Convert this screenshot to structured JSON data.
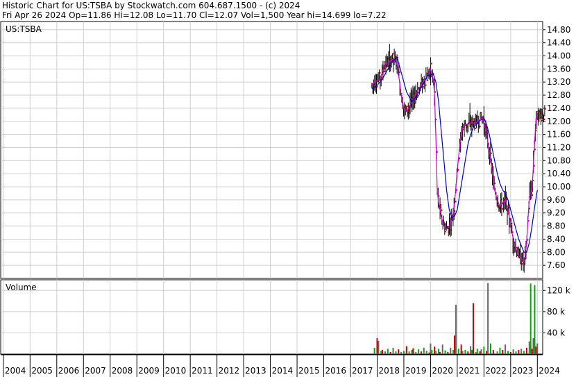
{
  "header": {
    "line1": "Historic Chart for US:TSBA by Stockwatch.com 604.687.1500 - (c) 2024",
    "line2": "Fri Apr 26 2024   Op=11.86   Hi=12.08   Lo=11.70   Cl=12.07   Vol=1,500   Year hi=14.699   lo=7.22"
  },
  "chart_data": [
    {
      "type": "line",
      "title": "US:TSBA",
      "ylim": [
        7.22,
        14.9
      ],
      "yticks": [
        "14.80",
        "14.40",
        "14.00",
        "13.60",
        "13.20",
        "12.80",
        "12.40",
        "12.00",
        "11.60",
        "11.20",
        "10.80",
        "10.40",
        "10.00",
        "9.60",
        "9.20",
        "8.80",
        "8.40",
        "8.00",
        "7.60"
      ],
      "colors": {
        "price_bar": "#000000",
        "down_tick": "#cc0000",
        "short_ma": "#cc00cc",
        "long_ma": "#0000cc"
      },
      "series": [
        {
          "values": [
            [
              2017.8,
              13.1
            ],
            [
              2017.9,
              13.2
            ],
            [
              2018.0,
              13.25
            ],
            [
              2018.1,
              13.3
            ],
            [
              2018.2,
              13.5
            ],
            [
              2018.3,
              13.75
            ],
            [
              2018.4,
              13.8
            ],
            [
              2018.5,
              13.85
            ],
            [
              2018.6,
              13.9
            ],
            [
              2018.75,
              13.8
            ],
            [
              2018.9,
              12.8
            ],
            [
              2019.0,
              12.4
            ],
            [
              2019.1,
              12.3
            ],
            [
              2019.3,
              12.6
            ],
            [
              2019.5,
              12.9
            ],
            [
              2019.7,
              13.2
            ],
            [
              2019.9,
              13.4
            ],
            [
              2020.0,
              13.6
            ],
            [
              2020.1,
              13.3
            ],
            [
              2020.15,
              12.8
            ],
            [
              2020.2,
              11.5
            ],
            [
              2020.25,
              9.9
            ],
            [
              2020.3,
              9.5
            ],
            [
              2020.4,
              9.1
            ],
            [
              2020.5,
              8.8
            ],
            [
              2020.6,
              8.7
            ],
            [
              2020.7,
              8.8
            ],
            [
              2020.8,
              9.0
            ],
            [
              2020.9,
              9.5
            ],
            [
              2021.0,
              10.5
            ],
            [
              2021.1,
              11.3
            ],
            [
              2021.2,
              11.8
            ],
            [
              2021.3,
              11.9
            ],
            [
              2021.5,
              11.95
            ],
            [
              2021.7,
              11.95
            ],
            [
              2021.9,
              12.1
            ],
            [
              2022.0,
              12.0
            ],
            [
              2022.1,
              11.6
            ],
            [
              2022.2,
              11.1
            ],
            [
              2022.3,
              10.5
            ],
            [
              2022.4,
              9.9
            ],
            [
              2022.5,
              9.6
            ],
            [
              2022.6,
              9.4
            ],
            [
              2022.7,
              9.5
            ],
            [
              2022.8,
              9.6
            ],
            [
              2022.9,
              9.3
            ],
            [
              2023.0,
              8.8
            ],
            [
              2023.1,
              8.4
            ],
            [
              2023.2,
              8.1
            ],
            [
              2023.3,
              7.9
            ],
            [
              2023.4,
              7.8
            ],
            [
              2023.5,
              7.7
            ],
            [
              2023.55,
              7.9
            ],
            [
              2023.6,
              8.3
            ],
            [
              2023.65,
              9.0
            ],
            [
              2023.7,
              9.7
            ],
            [
              2023.75,
              9.8
            ],
            [
              2023.8,
              9.9
            ],
            [
              2023.85,
              10.6
            ],
            [
              2023.9,
              11.4
            ],
            [
              2023.95,
              12.1
            ],
            [
              2024.0,
              12.2
            ]
          ]
        },
        {
          "values": [
            [
              2017.8,
              13.0
            ],
            [
              2018.0,
              13.1
            ],
            [
              2018.2,
              13.3
            ],
            [
              2018.4,
              13.6
            ],
            [
              2018.6,
              13.85
            ],
            [
              2018.75,
              13.95
            ],
            [
              2018.9,
              13.5
            ],
            [
              2019.1,
              12.9
            ],
            [
              2019.3,
              12.6
            ],
            [
              2019.5,
              12.8
            ],
            [
              2019.7,
              13.1
            ],
            [
              2019.9,
              13.4
            ],
            [
              2020.1,
              13.45
            ],
            [
              2020.2,
              13.2
            ],
            [
              2020.3,
              12.6
            ],
            [
              2020.4,
              11.7
            ],
            [
              2020.5,
              10.8
            ],
            [
              2020.6,
              9.9
            ],
            [
              2020.7,
              9.3
            ],
            [
              2020.8,
              9.05
            ],
            [
              2020.9,
              9.1
            ],
            [
              2021.0,
              9.3
            ],
            [
              2021.1,
              9.8
            ],
            [
              2021.2,
              10.3
            ],
            [
              2021.3,
              10.8
            ],
            [
              2021.4,
              11.3
            ],
            [
              2021.5,
              11.6
            ],
            [
              2021.6,
              11.8
            ],
            [
              2021.7,
              11.9
            ],
            [
              2021.8,
              12.0
            ],
            [
              2021.9,
              12.05
            ],
            [
              2022.0,
              12.1
            ],
            [
              2022.1,
              11.9
            ],
            [
              2022.2,
              11.6
            ],
            [
              2022.3,
              11.2
            ],
            [
              2022.4,
              10.8
            ],
            [
              2022.5,
              10.4
            ],
            [
              2022.6,
              10.1
            ],
            [
              2022.7,
              9.9
            ],
            [
              2022.8,
              9.8
            ],
            [
              2022.9,
              9.6
            ],
            [
              2023.0,
              9.3
            ],
            [
              2023.1,
              9.0
            ],
            [
              2023.2,
              8.7
            ],
            [
              2023.3,
              8.4
            ],
            [
              2023.4,
              8.2
            ],
            [
              2023.5,
              8.0
            ],
            [
              2023.6,
              8.0
            ],
            [
              2023.7,
              8.3
            ],
            [
              2023.8,
              8.8
            ],
            [
              2023.9,
              9.4
            ],
            [
              2024.0,
              9.9
            ]
          ]
        }
      ]
    },
    {
      "type": "bar",
      "title": "Volume",
      "yticks": [
        "120 k",
        "80 k",
        "40 k"
      ],
      "ylim": [
        0,
        140000
      ],
      "values": [
        [
          2017.9,
          12000
        ],
        [
          2018.0,
          30000
        ],
        [
          2018.05,
          25000
        ],
        [
          2018.15,
          6000
        ],
        [
          2018.2,
          8000
        ],
        [
          2018.3,
          5000
        ],
        [
          2018.4,
          10000
        ],
        [
          2018.5,
          4000
        ],
        [
          2018.6,
          12000
        ],
        [
          2018.7,
          5000
        ],
        [
          2018.8,
          9000
        ],
        [
          2018.9,
          4000
        ],
        [
          2019.0,
          6000
        ],
        [
          2019.1,
          15000
        ],
        [
          2019.2,
          5000
        ],
        [
          2019.3,
          8000
        ],
        [
          2019.35,
          11000
        ],
        [
          2019.45,
          4000
        ],
        [
          2019.55,
          9000
        ],
        [
          2019.65,
          5000
        ],
        [
          2019.75,
          12000
        ],
        [
          2019.85,
          6000
        ],
        [
          2019.95,
          3000
        ],
        [
          2020.0,
          20000
        ],
        [
          2020.05,
          8000
        ],
        [
          2020.15,
          14000
        ],
        [
          2020.2,
          6000
        ],
        [
          2020.3,
          10000
        ],
        [
          2020.35,
          4000
        ],
        [
          2020.45,
          18000
        ],
        [
          2020.55,
          7000
        ],
        [
          2020.65,
          4000
        ],
        [
          2020.75,
          12000
        ],
        [
          2020.85,
          8000
        ],
        [
          2020.9,
          35000
        ],
        [
          2020.95,
          93000
        ],
        [
          2021.05,
          10000
        ],
        [
          2021.15,
          18000
        ],
        [
          2021.2,
          6000
        ],
        [
          2021.3,
          8000
        ],
        [
          2021.4,
          5000
        ],
        [
          2021.5,
          15000
        ],
        [
          2021.55,
          8000
        ],
        [
          2021.6,
          96000
        ],
        [
          2021.7,
          4000
        ],
        [
          2021.75,
          10000
        ],
        [
          2021.85,
          5000
        ],
        [
          2021.9,
          9000
        ],
        [
          2022.0,
          14000
        ],
        [
          2022.1,
          6000
        ],
        [
          2022.15,
          134000
        ],
        [
          2022.25,
          20000
        ],
        [
          2022.35,
          8000
        ],
        [
          2022.5,
          5000
        ],
        [
          2022.6,
          12000
        ],
        [
          2022.7,
          8000
        ],
        [
          2022.8,
          18000
        ],
        [
          2022.9,
          6000
        ],
        [
          2023.0,
          4000
        ],
        [
          2023.1,
          9000
        ],
        [
          2023.2,
          5000
        ],
        [
          2023.3,
          8000
        ],
        [
          2023.4,
          10000
        ],
        [
          2023.5,
          6000
        ],
        [
          2023.6,
          12000
        ],
        [
          2023.7,
          24000
        ],
        [
          2023.75,
          133000
        ],
        [
          2023.8,
          10000
        ],
        [
          2023.85,
          30000
        ],
        [
          2023.9,
          130000
        ],
        [
          2023.95,
          14000
        ],
        [
          2024.0,
          20000
        ]
      ],
      "colors": {
        "up": "#00aa00",
        "down": "#cc0000",
        "neutral": "#666666"
      }
    }
  ],
  "xaxis": {
    "range": [
      2003.9,
      2024.2
    ],
    "labels": [
      "2004",
      "2005",
      "2006",
      "2007",
      "2008",
      "2009",
      "2010",
      "2011",
      "2012",
      "2013",
      "2014",
      "2015",
      "2016",
      "2017",
      "2018",
      "2019",
      "2020",
      "2021",
      "2022",
      "2023",
      "2024"
    ]
  }
}
